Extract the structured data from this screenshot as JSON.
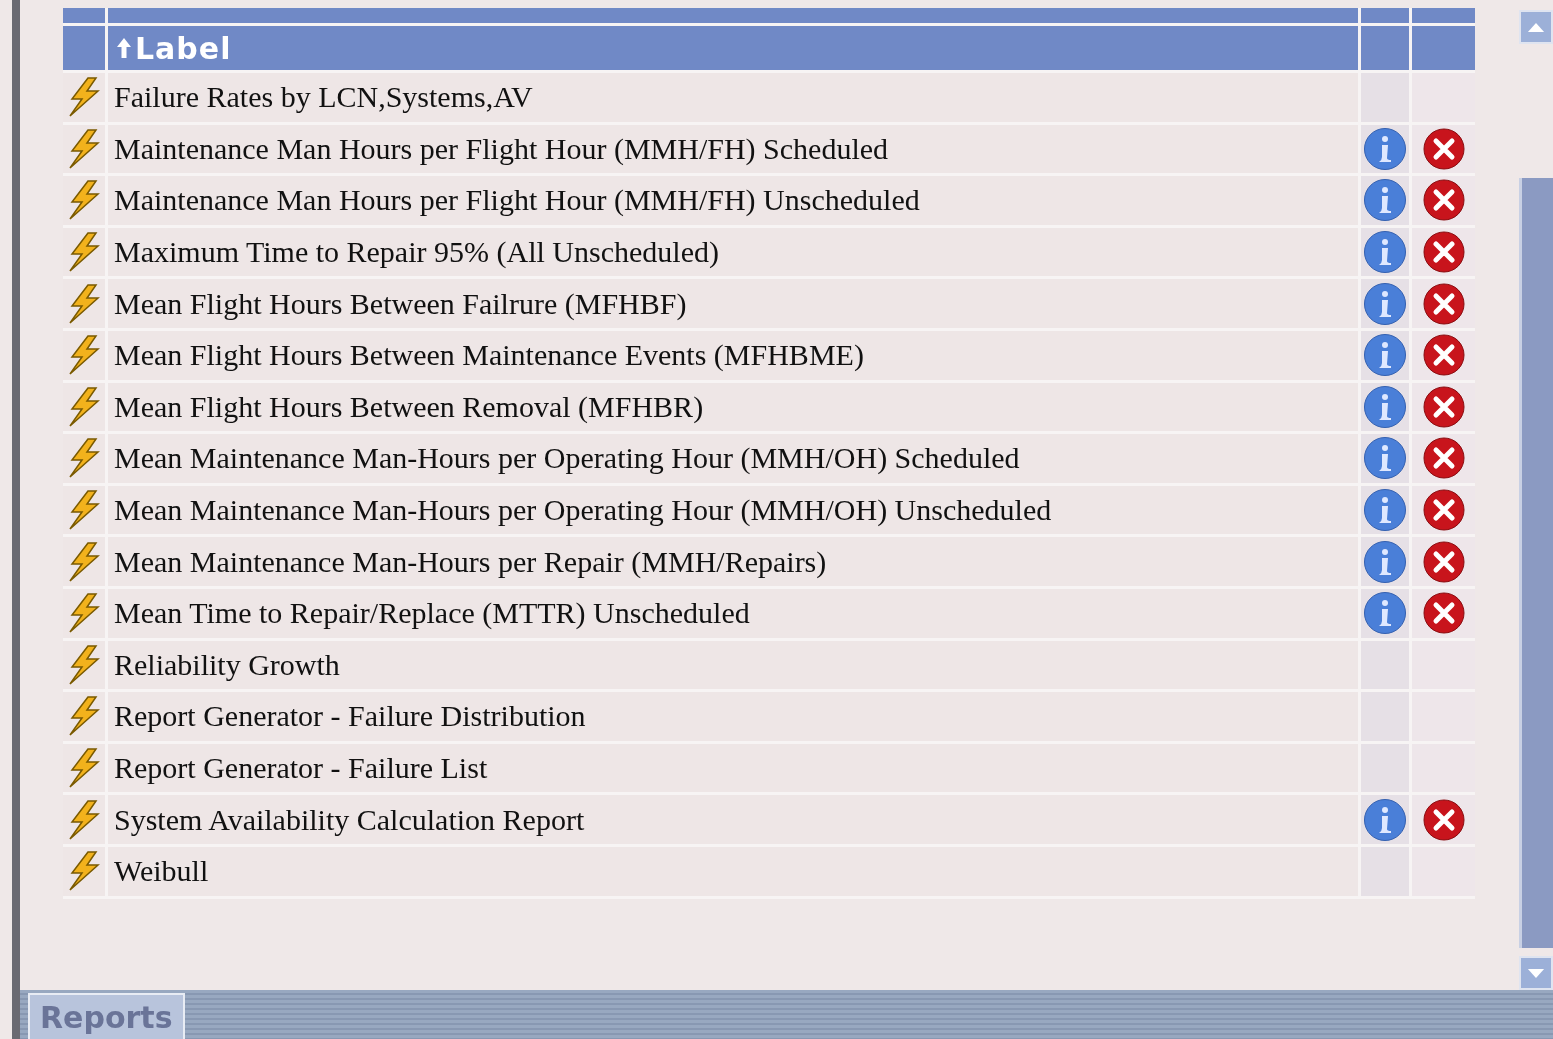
{
  "table": {
    "columns": [
      {
        "label": "Label",
        "sorted": true
      }
    ],
    "rows": [
      {
        "label": "Failure Rates by LCN,Systems,AV",
        "actions": false
      },
      {
        "label": "Maintenance Man Hours per Flight Hour (MMH/FH) Scheduled",
        "actions": true
      },
      {
        "label": "Maintenance Man Hours per Flight Hour (MMH/FH) Unscheduled",
        "actions": true
      },
      {
        "label": "Maximum Time to Repair 95% (All Unscheduled)",
        "actions": true
      },
      {
        "label": "Mean Flight Hours Between Failrure (MFHBF)",
        "actions": true
      },
      {
        "label": "Mean Flight Hours Between Maintenance Events (MFHBME)",
        "actions": true
      },
      {
        "label": "Mean Flight Hours Between Removal (MFHBR)",
        "actions": true
      },
      {
        "label": "Mean Maintenance Man-Hours per Operating Hour (MMH/OH) Scheduled",
        "actions": true
      },
      {
        "label": "Mean Maintenance Man-Hours per Operating Hour (MMH/OH) Unscheduled",
        "actions": true
      },
      {
        "label": "Mean Maintenance Man-Hours per Repair (MMH/Repairs)",
        "actions": true
      },
      {
        "label": "Mean Time to Repair/Replace (MTTR) Unscheduled",
        "actions": true
      },
      {
        "label": "Reliability Growth",
        "actions": false
      },
      {
        "label": "Report Generator - Failure Distribution",
        "actions": false
      },
      {
        "label": "Report Generator - Failure List",
        "actions": false
      },
      {
        "label": "System Availability Calculation Report",
        "actions": true
      },
      {
        "label": "Weibull",
        "actions": false
      }
    ]
  },
  "tabs": [
    {
      "label": "Reports",
      "selected": true
    }
  ]
}
